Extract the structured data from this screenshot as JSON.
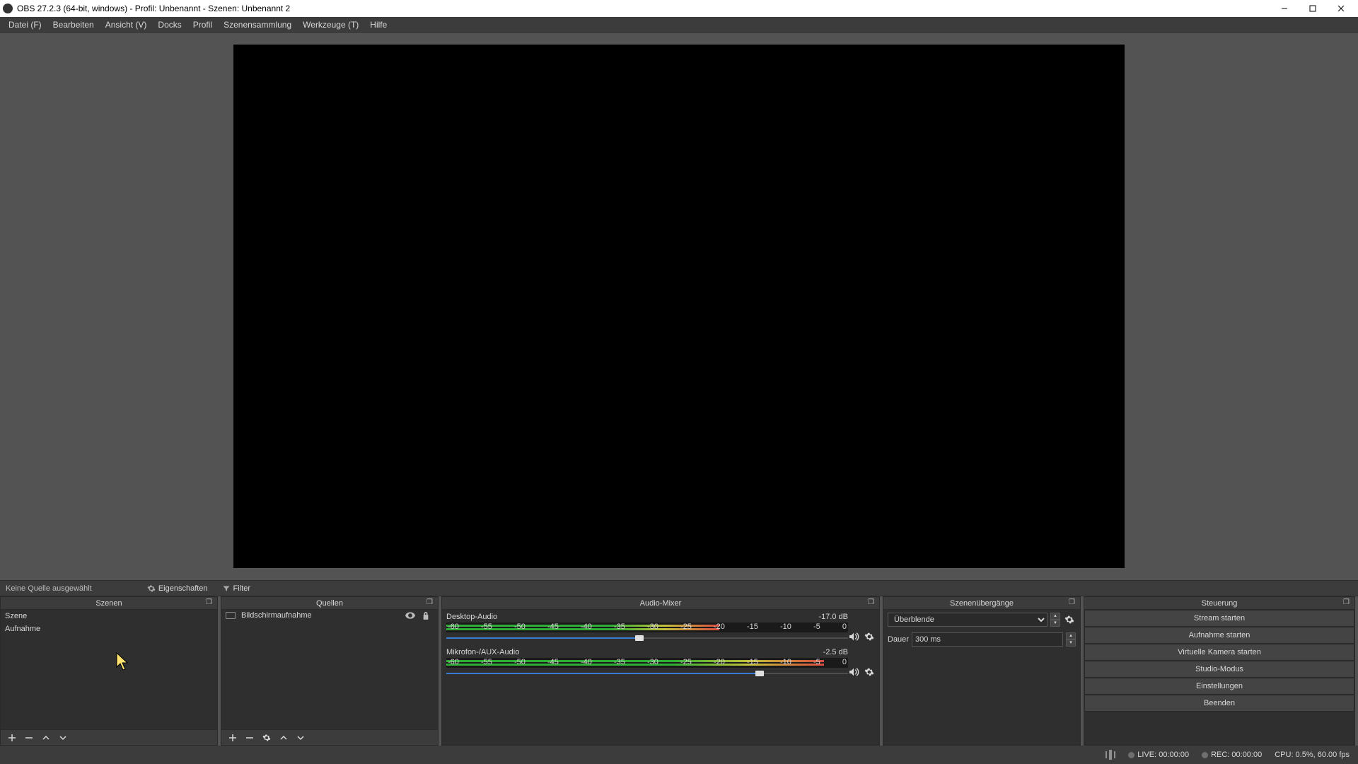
{
  "window": {
    "title": "OBS 27.2.3 (64-bit, windows) - Profil: Unbenannt - Szenen: Unbenannt 2"
  },
  "menu": {
    "items": [
      "Datei (F)",
      "Bearbeiten",
      "Ansicht (V)",
      "Docks",
      "Profil",
      "Szenensammlung",
      "Werkzeuge (T)",
      "Hilfe"
    ]
  },
  "toolbar": {
    "no_source": "Keine Quelle ausgewählt",
    "properties": "Eigenschaften",
    "filter": "Filter"
  },
  "docks": {
    "scenes": {
      "title": "Szenen",
      "items": [
        "Szene",
        "Aufnahme"
      ],
      "selected": 1
    },
    "sources": {
      "title": "Quellen",
      "items": [
        {
          "label": "Bildschirmaufnahme"
        }
      ]
    },
    "mixer": {
      "title": "Audio-Mixer",
      "ticks": [
        "-60",
        "-55",
        "-50",
        "-45",
        "-40",
        "-35",
        "-30",
        "-25",
        "-20",
        "-15",
        "-10",
        "-5",
        "0"
      ],
      "channels": [
        {
          "name": "Desktop-Audio",
          "db": "-17.0 dB",
          "level_pct": 68,
          "slider_pct": 48
        },
        {
          "name": "Mikrofon-/AUX-Audio",
          "db": "-2.5 dB",
          "level_pct": 94,
          "slider_pct": 78
        }
      ]
    },
    "transitions": {
      "title": "Szenenübergänge",
      "selected": "Überblende",
      "duration_label": "Dauer",
      "duration_value": "300 ms"
    },
    "controls": {
      "title": "Steuerung",
      "buttons": [
        "Stream starten",
        "Aufnahme starten",
        "Virtuelle Kamera starten",
        "Studio-Modus",
        "Einstellungen",
        "Beenden"
      ]
    }
  },
  "status": {
    "live": "LIVE: 00:00:00",
    "rec": "REC: 00:00:00",
    "cpu": "CPU: 0.5%, 60.00 fps"
  }
}
